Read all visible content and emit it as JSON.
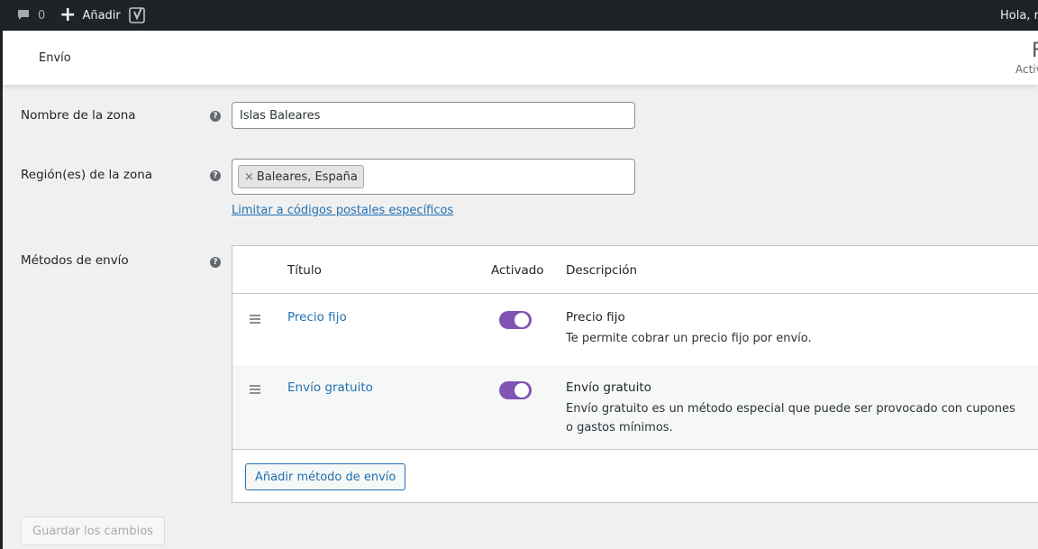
{
  "adminbar": {
    "comments_count": "0",
    "new_label": "Añadir",
    "howdy": "Hola, ro"
  },
  "header": {
    "title": "Envío",
    "right_big": "F",
    "right_small": "Activ"
  },
  "form": {
    "zone_name_label": "Nombre de la zona",
    "zone_name_value": "Islas Baleares",
    "zone_region_label": "Región(es) de la zona",
    "zone_region_chip": "Baleares, España",
    "postal_link": "Limitar a códigos postales específicos",
    "methods_label": "Métodos de envío",
    "help_glyph": "?"
  },
  "methods_table": {
    "headers": {
      "title": "Título",
      "enabled": "Activado",
      "description": "Descripción"
    },
    "rows": [
      {
        "title": "Precio fijo",
        "enabled": true,
        "desc_title": "Precio fijo",
        "desc_text": "Te permite cobrar un precio fijo por envío."
      },
      {
        "title": "Envío gratuito",
        "enabled": true,
        "desc_title": "Envío gratuito",
        "desc_text": "Envío gratuito es un método especial que puede ser provocado con cupones o gastos mínimos."
      }
    ],
    "add_button": "Añadir método de envío"
  },
  "save_button": "Guardar los cambios",
  "colors": {
    "toggle_on": "#7f54b3",
    "link": "#2271b1",
    "adminbar": "#1d2327"
  }
}
